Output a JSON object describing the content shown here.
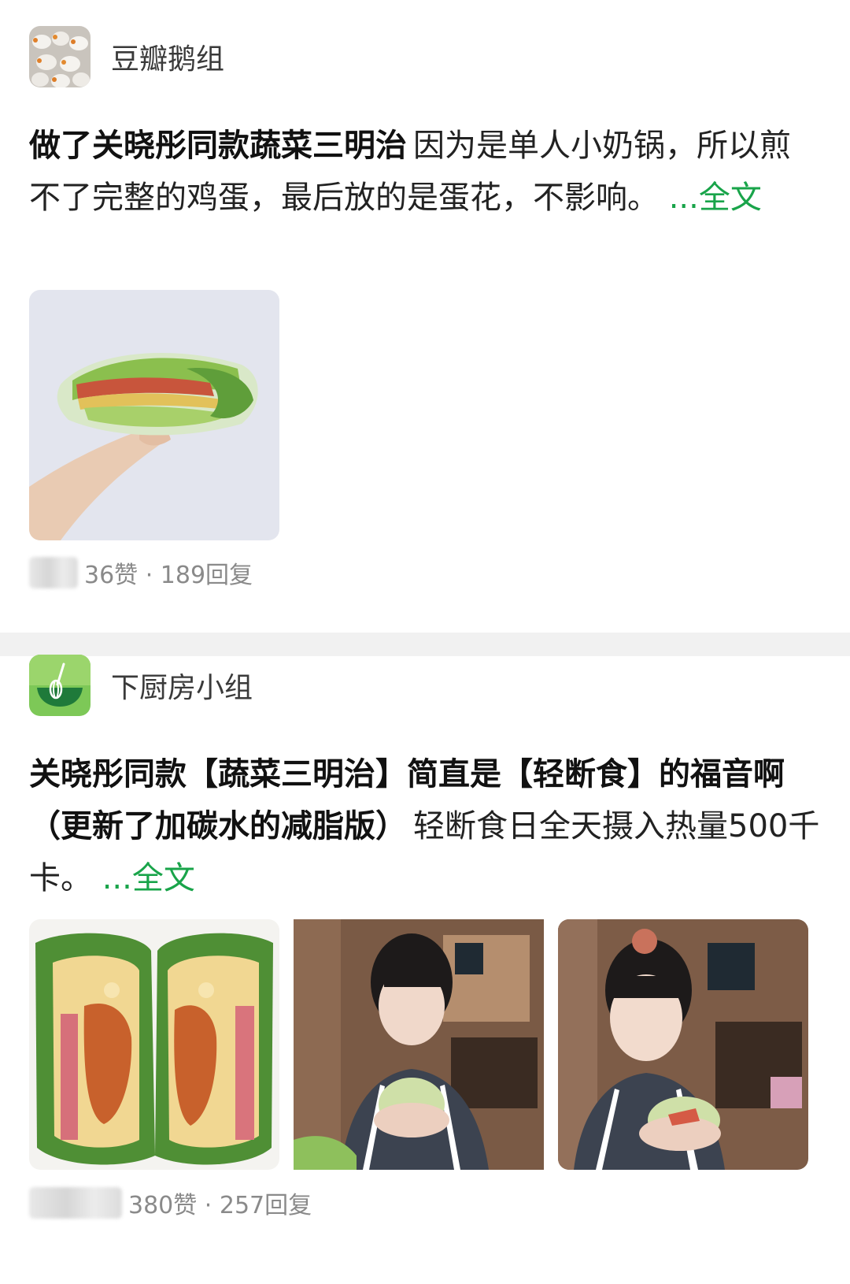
{
  "posts": [
    {
      "group": {
        "name": "豆瓣鹅组",
        "avatar_icon": "geese-photo-avatar"
      },
      "title": "做了关晓彤同款蔬菜三明治",
      "body": "因为是单人小奶锅，所以煎不了完整的鸡蛋，最后放的是蛋花，不影响。",
      "more_link": "...全文",
      "images": [
        "hand-holding-lettuce-sandwich"
      ],
      "stats": "36赞 · 189回复"
    },
    {
      "group": {
        "name": "下厨房小组",
        "avatar_icon": "whisk-bowl-icon"
      },
      "title": "关晓彤同款【蔬菜三明治】简直是【轻断食】的福音啊（更新了加碳水的减脂版）",
      "body": "轻断食日全天摄入热量500千卡。",
      "more_link": "...全文",
      "images": [
        "sandwich-cross-section",
        "woman-eating-sandwich",
        "woman-eating-sandwich-closeup"
      ],
      "stats": "380赞 · 257回复"
    }
  ],
  "colors": {
    "link_green": "#19a44a",
    "separator": "#f1f1f1",
    "stats_gray": "#8a8a8a",
    "avatar_green": "#6cc04a"
  }
}
